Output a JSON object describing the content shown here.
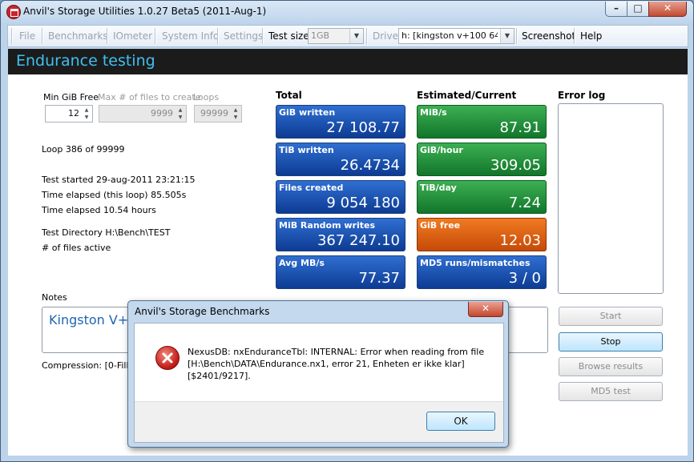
{
  "window": {
    "title": "Anvil's Storage Utilities 1.0.27 Beta5 (2011-Aug-1)",
    "min_glyph": "–",
    "max_glyph": "□",
    "close_glyph": "✕"
  },
  "menu": {
    "file": "File",
    "benchmarks": "Benchmarks",
    "iometer": "IOmeter",
    "system_info": "System Info",
    "settings": "Settings",
    "test_size_label": "Test size",
    "test_size_value": "1GB",
    "drive_label": "Drive",
    "drive_value": "h: [kingston v+100 64",
    "screenshot": "Screenshot",
    "help": "Help"
  },
  "header": {
    "title": "Endurance testing"
  },
  "params": {
    "min_gib_free_label": "Min GiB Free",
    "min_gib_free_value": "12",
    "max_files_label": "Max # of files to create",
    "max_files_value": "9999",
    "loops_label": "Loops",
    "loops_value": "99999"
  },
  "status": {
    "loop": "Loop 386 of 99999",
    "test_started": "Test started 29-aug-2011 23:21:15",
    "elapsed_loop": "Time elapsed (this loop) 85.505s",
    "elapsed_total": "Time elapsed 10.54 hours",
    "test_directory": "Test Directory H:\\Bench\\TEST",
    "files_active": "# of files active"
  },
  "totals": {
    "heading": "Total",
    "tiles": [
      {
        "label": "GiB written",
        "value": "27 108.77"
      },
      {
        "label": "TiB written",
        "value": "26.4734"
      },
      {
        "label": "Files created",
        "value": "9 054 180"
      },
      {
        "label": "MiB Random writes",
        "value": "367 247.10"
      },
      {
        "label": "Avg MB/s",
        "value": "77.37"
      }
    ]
  },
  "estimated": {
    "heading": "Estimated/Current",
    "tiles": [
      {
        "label": "MiB/s",
        "value": "87.91"
      },
      {
        "label": "GiB/hour",
        "value": "309.05"
      },
      {
        "label": "TiB/day",
        "value": "7.24"
      },
      {
        "label": "GiB free",
        "value": "12.03"
      },
      {
        "label": "MD5 runs/mismatches",
        "value": "3 / 0"
      }
    ]
  },
  "error_log": {
    "heading": "Error log"
  },
  "buttons": {
    "start": "Start",
    "stop": "Stop",
    "browse": "Browse results",
    "md5": "MD5 test"
  },
  "notes": {
    "label": "Notes",
    "text": "Kingston V+1",
    "compression": "Compression: [0-Fill]"
  },
  "dialog": {
    "title": "Anvil's Storage Benchmarks",
    "close_glyph": "✕",
    "message_line1": "NexusDB: nxEnduranceTbl: INTERNAL: Error when reading from file",
    "message_line2": "[H:\\Bench\\DATA\\Endurance.nx1, error 21, Enheten er ikke klar]",
    "message_line3": "[$2401/9217].",
    "ok": "OK"
  }
}
